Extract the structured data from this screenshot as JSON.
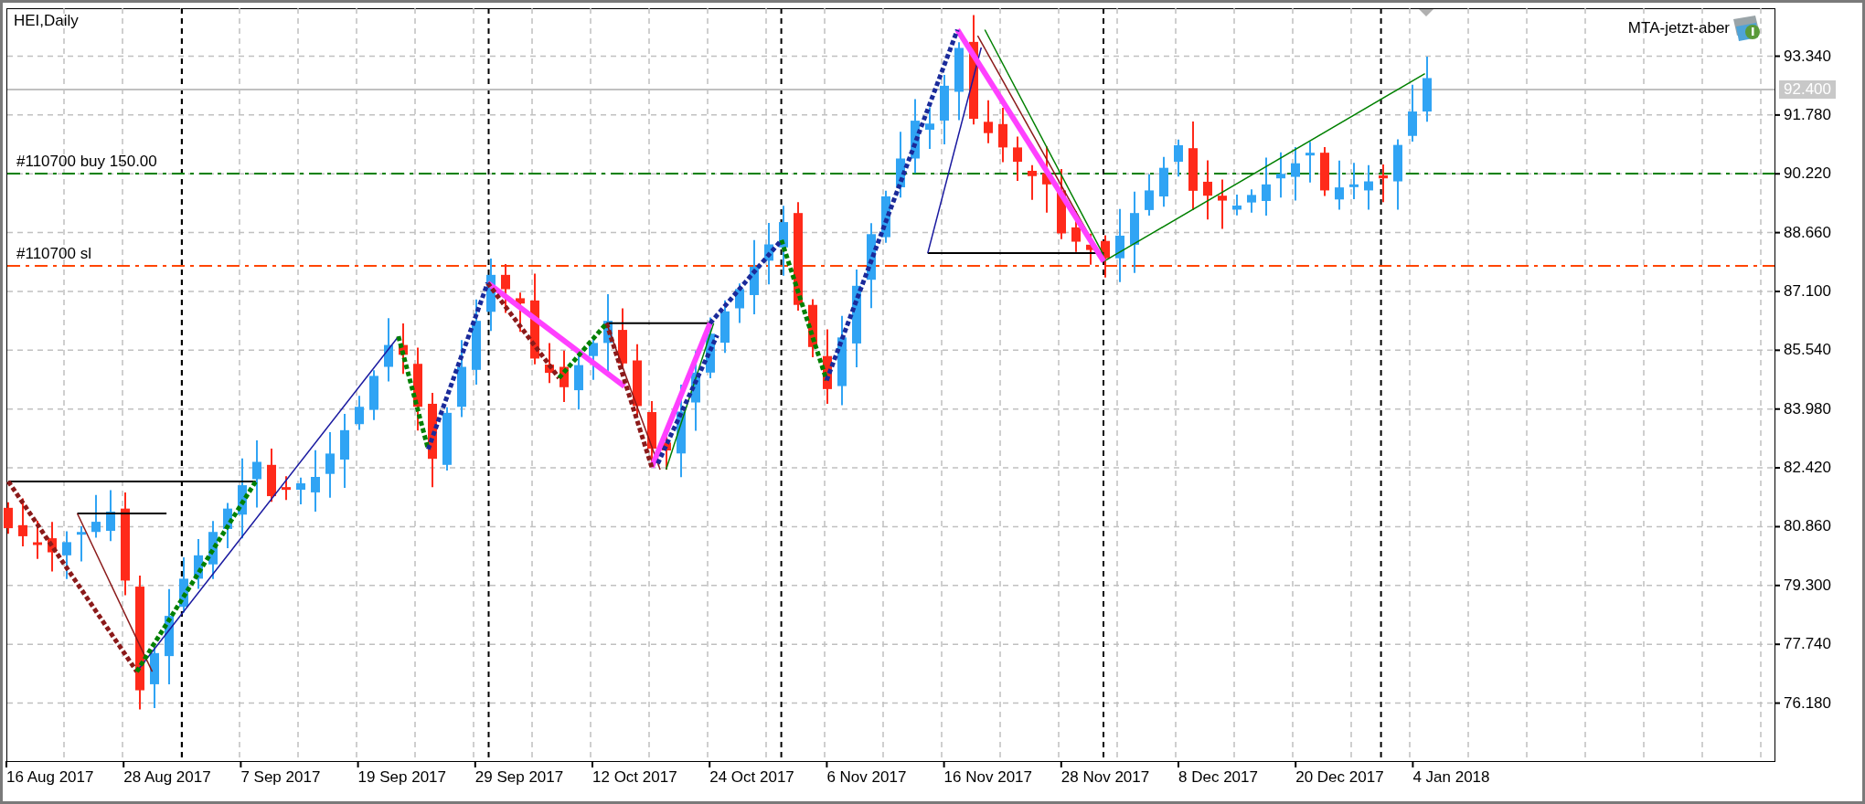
{
  "chart": {
    "title": "HEI,Daily",
    "expert": {
      "name": "MTA-jetzt-aber"
    },
    "orders": [
      {
        "kind": "entry",
        "label": "#110700 buy 150.00"
      },
      {
        "kind": "stop",
        "label": "#110700 sl"
      }
    ],
    "current_price": "92.400",
    "price_axis": [
      "93.340",
      "91.780",
      "90.220",
      "88.660",
      "87.100",
      "85.540",
      "83.980",
      "82.420",
      "80.860",
      "79.300",
      "77.740",
      "76.180"
    ],
    "time_axis": [
      "16 Aug 2017",
      "28 Aug 2017",
      "7 Sep 2017",
      "19 Sep 2017",
      "29 Sep 2017",
      "12 Oct 2017",
      "24 Oct 2017",
      "6 Nov 2017",
      "16 Nov 2017",
      "28 Nov 2017",
      "8 Dec 2017",
      "20 Dec 2017",
      "4 Jan 2018"
    ]
  }
}
